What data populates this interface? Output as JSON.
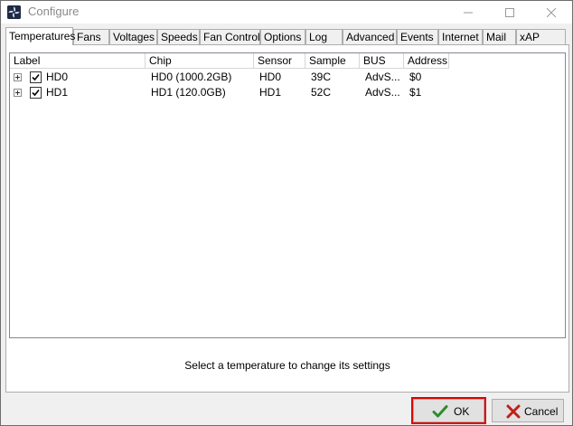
{
  "window": {
    "title": "Configure"
  },
  "tabs": [
    {
      "label": "Temperatures",
      "active": true
    },
    {
      "label": "Fans"
    },
    {
      "label": "Voltages"
    },
    {
      "label": "Speeds"
    },
    {
      "label": "Fan Control"
    },
    {
      "label": "Options"
    },
    {
      "label": "Log"
    },
    {
      "label": "Advanced"
    },
    {
      "label": "Events"
    },
    {
      "label": "Internet"
    },
    {
      "label": "Mail"
    },
    {
      "label": "xAP"
    }
  ],
  "list": {
    "columns": [
      "Label",
      "Chip",
      "Sensor",
      "Sample",
      "BUS",
      "Address"
    ],
    "rows": [
      {
        "label": "HD0",
        "chip": "HD0 (1000.2GB)",
        "sensor": "HD0",
        "sample": "39C",
        "bus": "AdvS...",
        "address": "$0",
        "checked": true
      },
      {
        "label": "HD1",
        "chip": "HD1 (120.0GB)",
        "sensor": "HD1",
        "sample": "52C",
        "bus": "AdvS...",
        "address": "$1",
        "checked": true
      }
    ]
  },
  "status_text": "Select a temperature to change its settings",
  "buttons": {
    "ok": "OK",
    "cancel": "Cancel"
  },
  "colors": {
    "ok_highlight": "#e00000",
    "check_green": "#2e8b2e",
    "cancel_red": "#c0201a"
  },
  "icons": {
    "app": "fan-icon",
    "ok": "green-check-icon",
    "cancel": "red-x-icon"
  }
}
